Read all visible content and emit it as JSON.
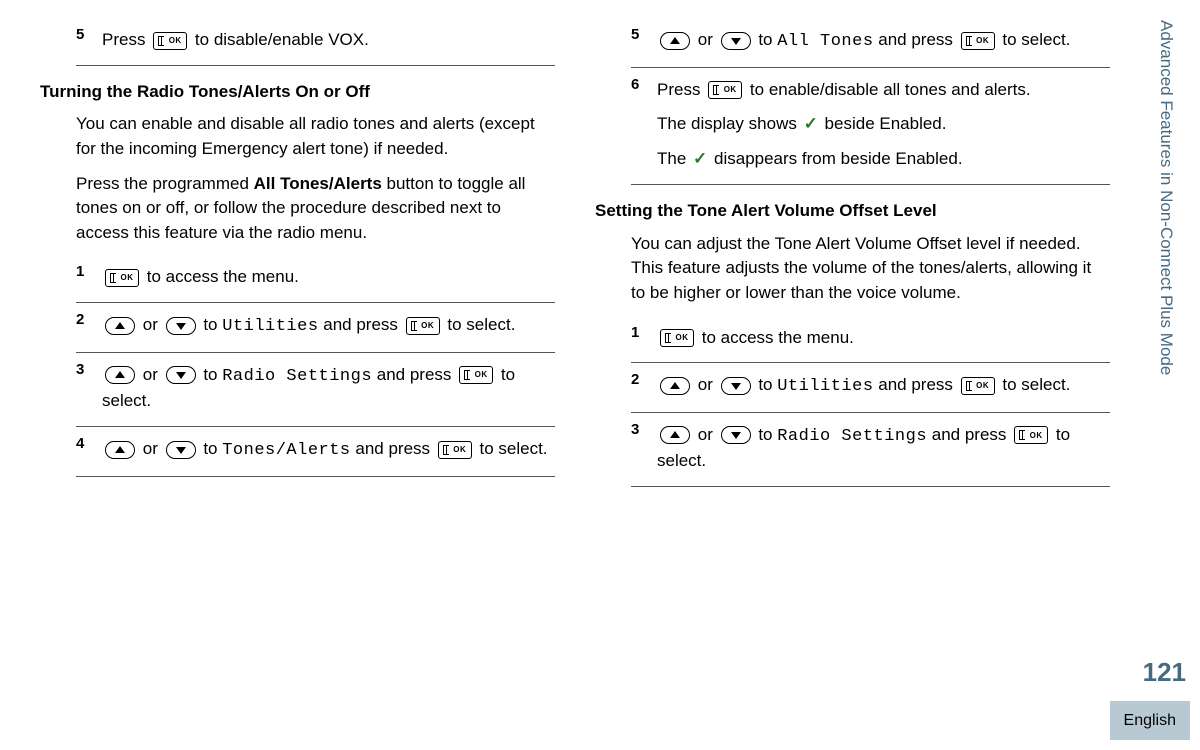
{
  "sidebar": "Advanced Features in Non-Connect Plus Mode",
  "page_number": "121",
  "language": "English",
  "left": {
    "step5_start": {
      "num": "5",
      "prefix": "Press ",
      "suffix": " to disable/enable VOX."
    },
    "heading": "Turning the Radio Tones/Alerts On or Off",
    "intro1": "You can enable and disable all radio tones and alerts (except for the incoming Emergency alert tone) if needed.",
    "intro2_a": "Press the programmed ",
    "intro2_b": "All Tones/Alerts",
    "intro2_c": " button to toggle all tones on or off, or follow the procedure described next to access this feature via the radio menu.",
    "s1": {
      "num": "1",
      "suffix": " to access the menu."
    },
    "s2": {
      "num": "2",
      "mid_to": " to ",
      "target": "Utilities",
      "mid_press": " and press ",
      "suffix": " to select."
    },
    "s3": {
      "num": "3",
      "mid_to": " to ",
      "target": "Radio Settings",
      "mid_press": " and press ",
      "suffix": " to select."
    },
    "s4": {
      "num": "4",
      "mid_to": " to ",
      "target": "Tones/Alerts",
      "mid_press": " and press ",
      "suffix": " to select."
    }
  },
  "right": {
    "s5": {
      "num": "5",
      "mid_to": " to ",
      "target": "All Tones",
      "mid_press": " and press ",
      "suffix": " to select."
    },
    "s6": {
      "num": "6",
      "line1_a": "Press ",
      "line1_b": " to enable/disable all tones and alerts.",
      "line2_a": "The display shows ",
      "line2_b": " beside Enabled.",
      "line3_a": "The ",
      "line3_b": " disappears from beside Enabled."
    },
    "heading": "Setting the Tone Alert Volume Offset Level",
    "intro": "You can adjust the Tone Alert Volume Offset level if needed. This feature adjusts the volume of the tones/alerts, allowing it to be higher or lower than the voice volume.",
    "s1": {
      "num": "1",
      "suffix": " to access the menu."
    },
    "s2": {
      "num": "2",
      "mid_to": " to ",
      "target": "Utilities",
      "mid_press": " and press ",
      "suffix": " to select."
    },
    "s3": {
      "num": "3",
      "mid_to": " to ",
      "target": "Radio Settings",
      "mid_press": " and press ",
      "suffix": " to select."
    }
  },
  "words": {
    "or": " or "
  }
}
